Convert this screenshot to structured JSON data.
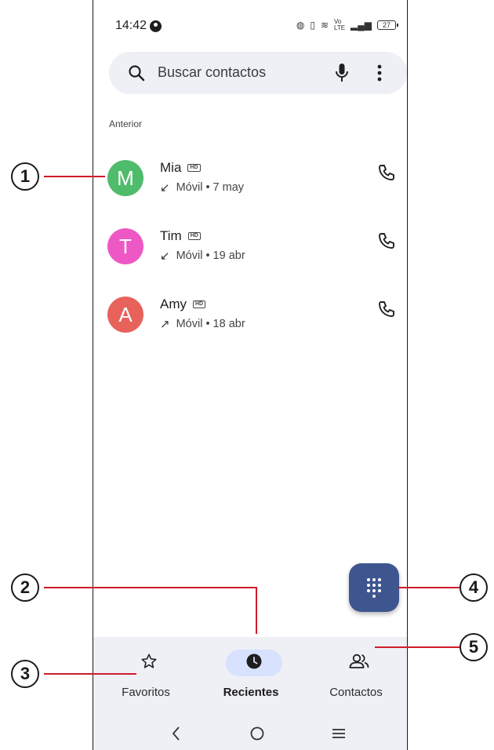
{
  "status_bar": {
    "time": "14:42",
    "network": "4G",
    "volte": "Vo LTE",
    "battery": "27"
  },
  "search": {
    "placeholder": "Buscar contactos"
  },
  "section_label": "Anterior",
  "calls": [
    {
      "initial": "M",
      "name": "Mia",
      "hd": "HD",
      "direction": "incoming",
      "arrow": "↙",
      "meta": "Móvil • 7 may",
      "avatar_color": "#4fbc6b"
    },
    {
      "initial": "T",
      "name": "Tim",
      "hd": "HD",
      "direction": "incoming",
      "arrow": "↙",
      "meta": "Móvil • 19 abr",
      "avatar_color": "#ee58c4"
    },
    {
      "initial": "A",
      "name": "Amy",
      "hd": "HD",
      "direction": "outgoing",
      "arrow": "↗",
      "meta": "Móvil • 18 abr",
      "avatar_color": "#e8625c"
    }
  ],
  "fab": {
    "icon": "dialpad-icon",
    "color": "#3e568f"
  },
  "bottom_nav": {
    "items": [
      {
        "label": "Favoritos",
        "icon": "star-icon",
        "active": false
      },
      {
        "label": "Recientes",
        "icon": "clock-icon",
        "active": true
      },
      {
        "label": "Contactos",
        "icon": "people-icon",
        "active": false
      }
    ]
  },
  "callouts": [
    "1",
    "2",
    "3",
    "4",
    "5"
  ],
  "colors": {
    "accent_line": "#d11b2a",
    "nav_background": "#eef0f6",
    "active_pill": "#d8e2ff"
  }
}
